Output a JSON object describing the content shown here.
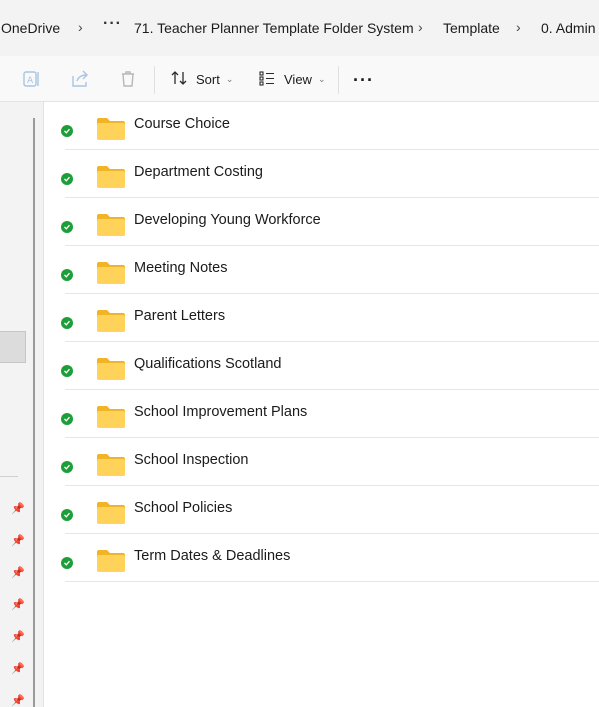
{
  "breadcrumb": {
    "items": [
      "OneDrive",
      "71. Teacher Planner Template Folder System",
      "Template",
      "0. Admin"
    ],
    "overflow": "···"
  },
  "toolbar": {
    "sort_label": "Sort",
    "view_label": "View",
    "more_label": "···",
    "icons": [
      "rename-icon",
      "share-icon",
      "delete-icon",
      "sort-icon",
      "view-icon"
    ]
  },
  "folders": [
    {
      "name": "Course Choice",
      "status": "synced"
    },
    {
      "name": "Department Costing",
      "status": "synced"
    },
    {
      "name": "Developing Young Workforce",
      "status": "synced"
    },
    {
      "name": "Meeting Notes",
      "status": "synced"
    },
    {
      "name": "Parent Letters",
      "status": "synced"
    },
    {
      "name": "Qualifications Scotland",
      "status": "synced"
    },
    {
      "name": "School Improvement Plans",
      "status": "synced"
    },
    {
      "name": "School Inspection",
      "status": "synced"
    },
    {
      "name": "School Policies",
      "status": "synced"
    },
    {
      "name": "Term Dates & Deadlines",
      "status": "synced"
    }
  ],
  "colors": {
    "sync_ok": "#1e9e3b",
    "folder_front": "#ffd35a",
    "folder_back": "#f0b429"
  }
}
